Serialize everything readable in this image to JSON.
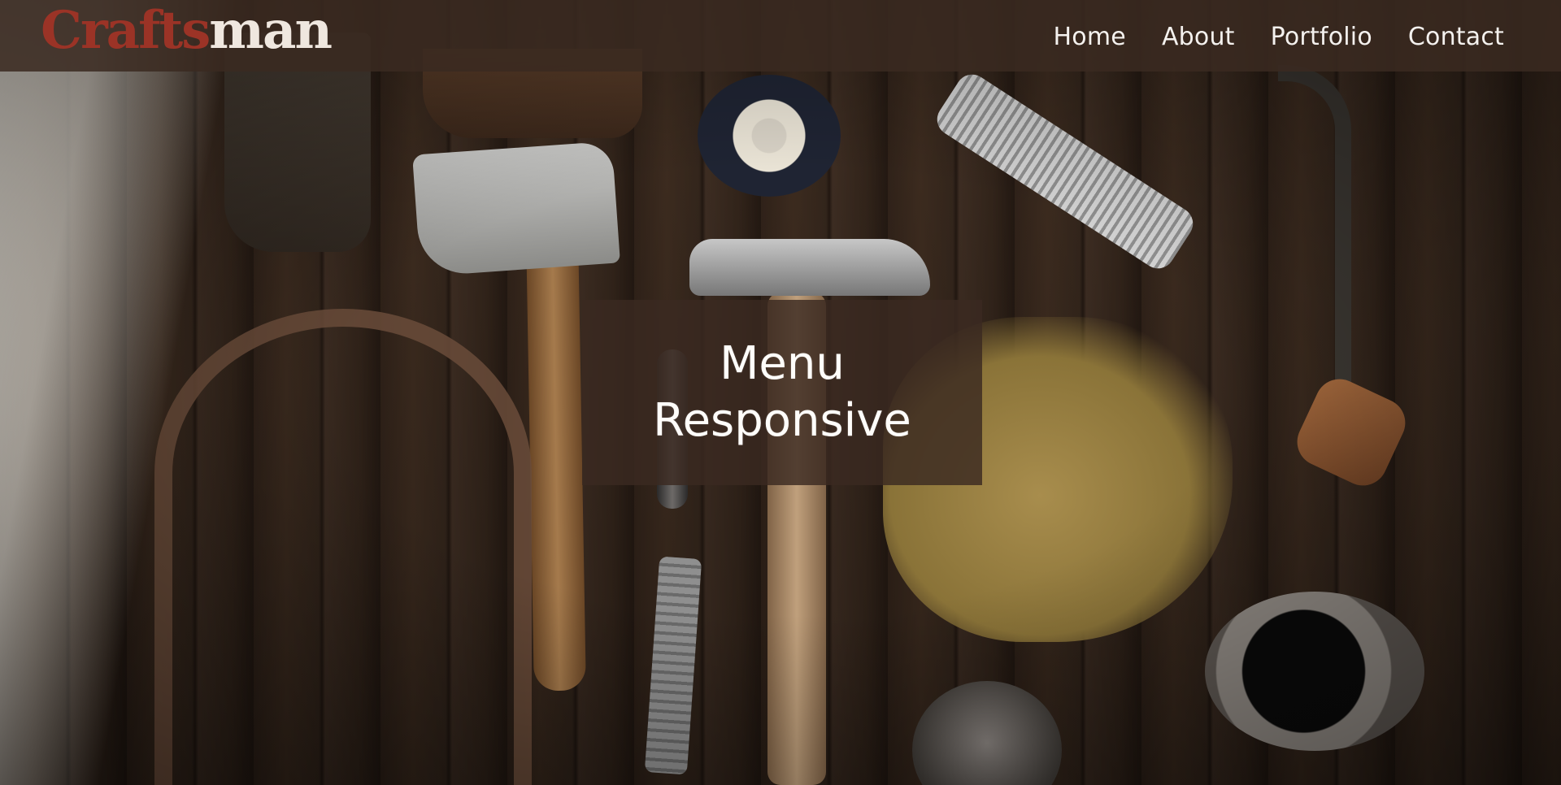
{
  "brand": {
    "part_a": "Crafts",
    "part_b": "man",
    "color_a": "#9b3326",
    "color_b": "#efe7df"
  },
  "nav": {
    "items": [
      {
        "label": "Home"
      },
      {
        "label": "About"
      },
      {
        "label": "Portfolio"
      },
      {
        "label": "Contact"
      }
    ]
  },
  "hero": {
    "line1": "Menu",
    "line2": "Responsive",
    "overlay_color": "#3a2a21"
  },
  "colors": {
    "header_bg": "#3a2a21",
    "nav_text": "#f4f1ee"
  }
}
